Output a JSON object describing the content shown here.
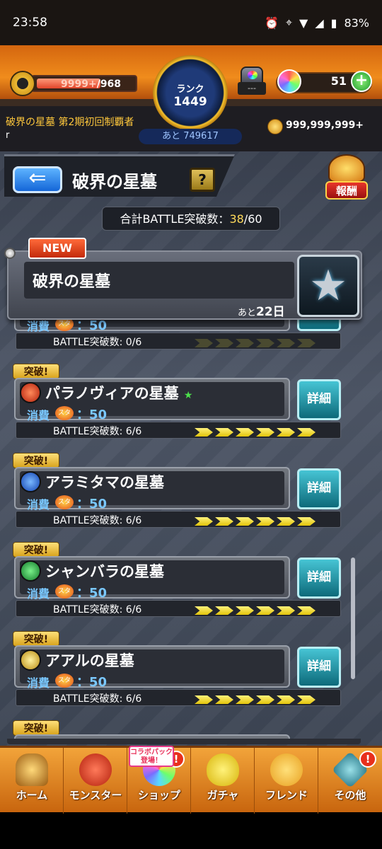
{
  "status_bar": {
    "time": "23:58",
    "battery": "83%",
    "icons": [
      "alarm-icon",
      "location-icon",
      "wifi-icon",
      "signal-icon",
      "battery-icon"
    ]
  },
  "header": {
    "stamina_current": "9999+",
    "stamina_max": "/968",
    "rank_label": "ランク",
    "rank_value": "1449",
    "rank_exp_remaining": "あと 749617",
    "chest_count": "---",
    "orb_count": "51",
    "plus_label": "+",
    "player_title": "破界の星墓 第2期初回制覇者",
    "player_name": "r",
    "coins": "999,999,999+"
  },
  "page": {
    "back_icon": "back-arrow-icon",
    "title": "破界の星墓",
    "help_label": "?",
    "reward_label": "報酬",
    "total_label": "合計BATTLE突破数：",
    "total_current": "38",
    "total_max": "/60"
  },
  "event": {
    "new_label": "NEW",
    "name": "破界の星墓",
    "remaining_prefix": "あと",
    "remaining_days": "22日"
  },
  "quests": [
    {
      "badge": "",
      "name": "",
      "cost_label": "消費",
      "stamina_icon_label": "スタミナ",
      "cost_value": "：50",
      "detail_label": "詳細",
      "progress_text": "BATTLE突破数: 0/6",
      "progress_fraction": 0,
      "element": "none"
    },
    {
      "badge": "突破!",
      "name": "パラノヴィアの星墓",
      "cleared_star": "★",
      "cost_label": "消費",
      "stamina_icon_label": "スタミナ",
      "cost_value": "：50",
      "detail_label": "詳細",
      "progress_text": "BATTLE突破数: 6/6",
      "progress_fraction": 1,
      "element": "fire",
      "element_color": "#e0381c"
    },
    {
      "badge": "突破!",
      "name": "アラミタマの星墓",
      "cost_label": "消費",
      "stamina_icon_label": "スタミナ",
      "cost_value": "：50",
      "detail_label": "詳細",
      "progress_text": "BATTLE突破数: 6/6",
      "progress_fraction": 1,
      "element": "water",
      "element_color": "#2a7af0"
    },
    {
      "badge": "突破!",
      "name": "シャンバラの星墓",
      "cost_label": "消費",
      "stamina_icon_label": "スタミナ",
      "cost_value": "：50",
      "detail_label": "詳細",
      "progress_text": "BATTLE突破数: 6/6",
      "progress_fraction": 1,
      "element": "wood",
      "element_color": "#2ab04a"
    },
    {
      "badge": "突破!",
      "name": "アアルの星墓",
      "cost_label": "消費",
      "stamina_icon_label": "スタミナ",
      "cost_value": "：50",
      "detail_label": "詳細",
      "progress_text": "BATTLE突破数: 6/6",
      "progress_fraction": 1,
      "element": "light",
      "element_color": "#e8c43a"
    },
    {
      "badge": "突破!",
      "name": "",
      "element": "none"
    }
  ],
  "bottom_nav": [
    {
      "label": "ホーム",
      "icon": "home-icon",
      "alert": ""
    },
    {
      "label": "モンスター",
      "icon": "monster-icon",
      "alert": ""
    },
    {
      "label": "ショップ",
      "icon": "shop-icon",
      "alert": "!",
      "promo": "コラボパック 登場！"
    },
    {
      "label": "ガチャ",
      "icon": "gacha-icon",
      "alert": ""
    },
    {
      "label": "フレンド",
      "icon": "friend-icon",
      "alert": ""
    },
    {
      "label": "その他",
      "icon": "other-icon",
      "alert": "!"
    }
  ]
}
